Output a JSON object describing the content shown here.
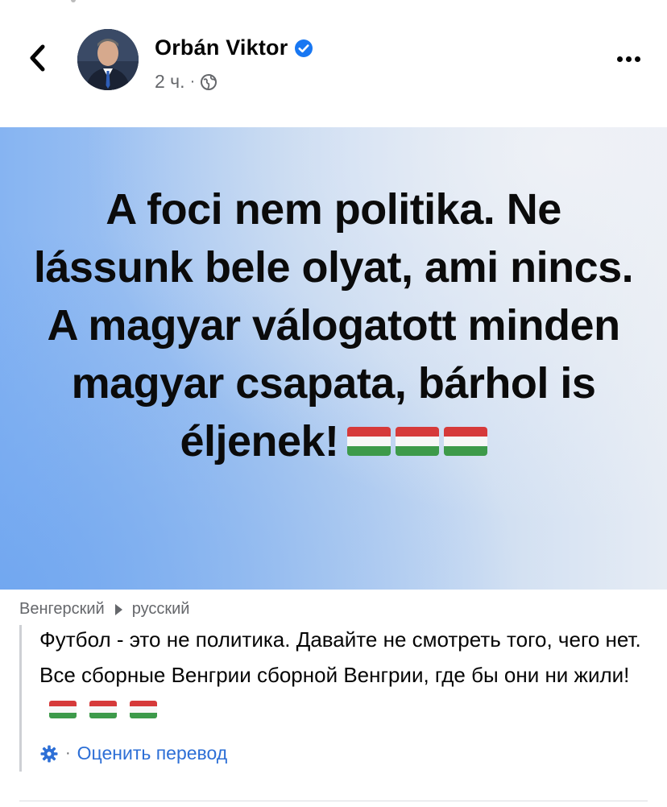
{
  "post": {
    "author": "Orbán Viktor",
    "time": "2 ч.",
    "separator": "·",
    "image_text": "A foci nem politika. Ne lássunk bele olyat, ami nincs. A magyar válogatott minden magyar csapata, bárhol is éljenek!"
  },
  "translation": {
    "source_lang": "Венгерский",
    "target_lang": "русский",
    "text": "Футбол - это не политика. Давайте не смотреть того, чего нет. Все сборные Венгрии сборной Венгрии, где бы они ни жили!",
    "separator": "·",
    "rate_label": "Оценить перевод"
  },
  "icons": {
    "back": "chevron-left-icon",
    "verified": "verified-badge-icon",
    "privacy": "globe-icon",
    "more": "more-options-icon",
    "arrow": "arrow-right-icon",
    "settings": "gear-icon",
    "flag": "hungary-flag-icon"
  },
  "colors": {
    "verified": "#1877f2",
    "link": "#2d6fd6",
    "muted": "#65676b"
  }
}
